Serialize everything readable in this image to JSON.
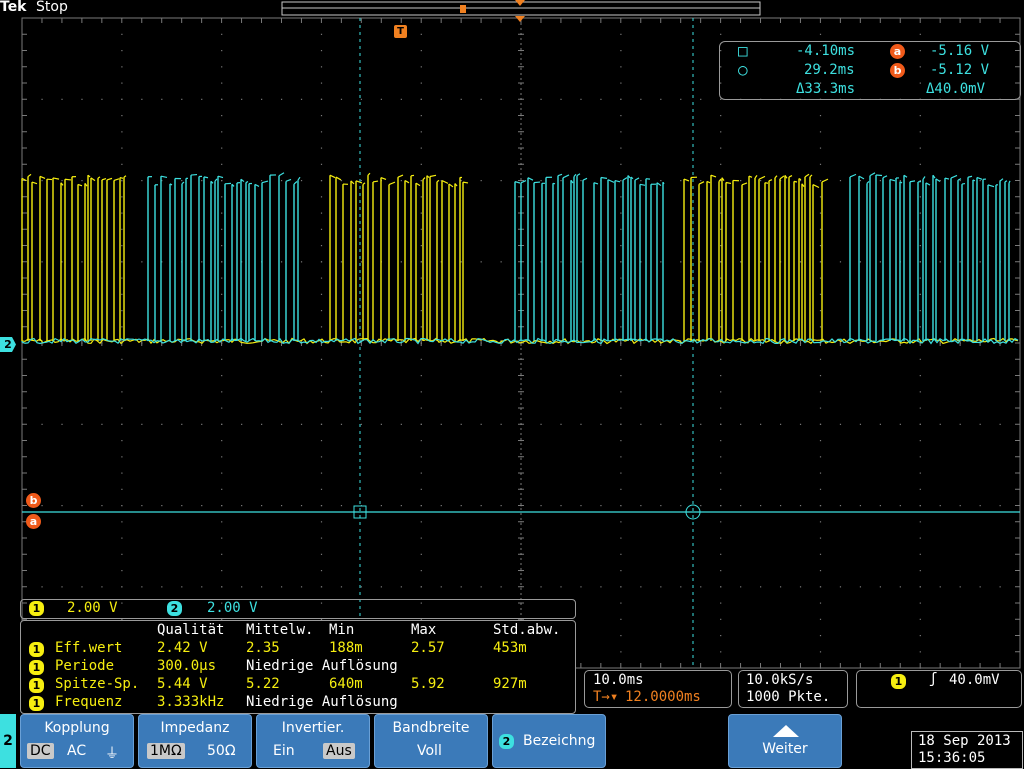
{
  "header": {
    "brand": "Tek",
    "status": "Stop"
  },
  "cursor_readout": {
    "row1": {
      "symbol": "□",
      "time": "-4.10ms",
      "marker": "a",
      "voltage": "-5.16 V"
    },
    "row2": {
      "symbol": "○",
      "time": "29.2ms",
      "marker": "b",
      "voltage": "-5.12 V"
    },
    "row3": {
      "delta_time": "Δ33.3ms",
      "delta_voltage": "Δ40.0mV"
    }
  },
  "markers": {
    "trigger": "T",
    "channel_2": "2",
    "ref_b": "b",
    "ref_a": "a"
  },
  "channel_scales": [
    {
      "channel": "1",
      "scale": "2.00 V"
    },
    {
      "channel": "2",
      "scale": "2.00 V"
    }
  ],
  "measurements": {
    "headers": [
      "Qualität",
      "Mittelw.",
      "Min",
      "Max",
      "Std.abw."
    ],
    "rows": [
      {
        "channel": "1",
        "name": "Eff.wert",
        "value": "2.42 V",
        "mean": "2.35",
        "min": "188m",
        "max": "2.57",
        "std": "453m",
        "note": ""
      },
      {
        "channel": "1",
        "name": "Periode",
        "value": "300.0µs",
        "mean": "",
        "min": "",
        "max": "",
        "std": "",
        "note": "Niedrige Auflösung"
      },
      {
        "channel": "1",
        "name": "Spitze-Sp.",
        "value": "5.44 V",
        "mean": "5.22",
        "min": "640m",
        "max": "5.92",
        "std": "927m",
        "note": ""
      },
      {
        "channel": "1",
        "name": "Frequenz",
        "value": "3.333kHz",
        "mean": "",
        "min": "",
        "max": "",
        "std": "",
        "note": "Niedrige Auflösung"
      }
    ]
  },
  "timebase": {
    "scale": "10.0ms",
    "position": "12.0000ms",
    "position_prefix": "T→▾"
  },
  "acquisition": {
    "rate": "10.0kS/s",
    "length": "1000 Pkte."
  },
  "trigger": {
    "channel": "1",
    "slope": "ʃ",
    "level": "40.0mV"
  },
  "menu": {
    "channel": "2",
    "kopplung": {
      "label": "Kopplung",
      "options": [
        "DC",
        "AC",
        "⏚"
      ],
      "selected": "DC"
    },
    "impedanz": {
      "label": "Impedanz",
      "options": [
        "1MΩ",
        "50Ω"
      ],
      "selected": "1MΩ"
    },
    "invertier": {
      "label": "Invertier.",
      "options": [
        "Ein",
        "Aus"
      ],
      "selected": "Aus"
    },
    "bandbreite": {
      "label": "Bandbreite",
      "value": "Voll"
    },
    "bezeichnung": {
      "channel": "2",
      "label": "Bezeichng"
    },
    "weiter": {
      "label": "Weiter"
    }
  },
  "datetime": {
    "date": "18 Sep 2013",
    "time": "15:36:05"
  },
  "colors": {
    "ch1": "#f6ee10",
    "ch2": "#3de0e0",
    "ref": "#f05a1a",
    "button": "#3b7ab9",
    "grid": "#7a7a7a"
  }
}
